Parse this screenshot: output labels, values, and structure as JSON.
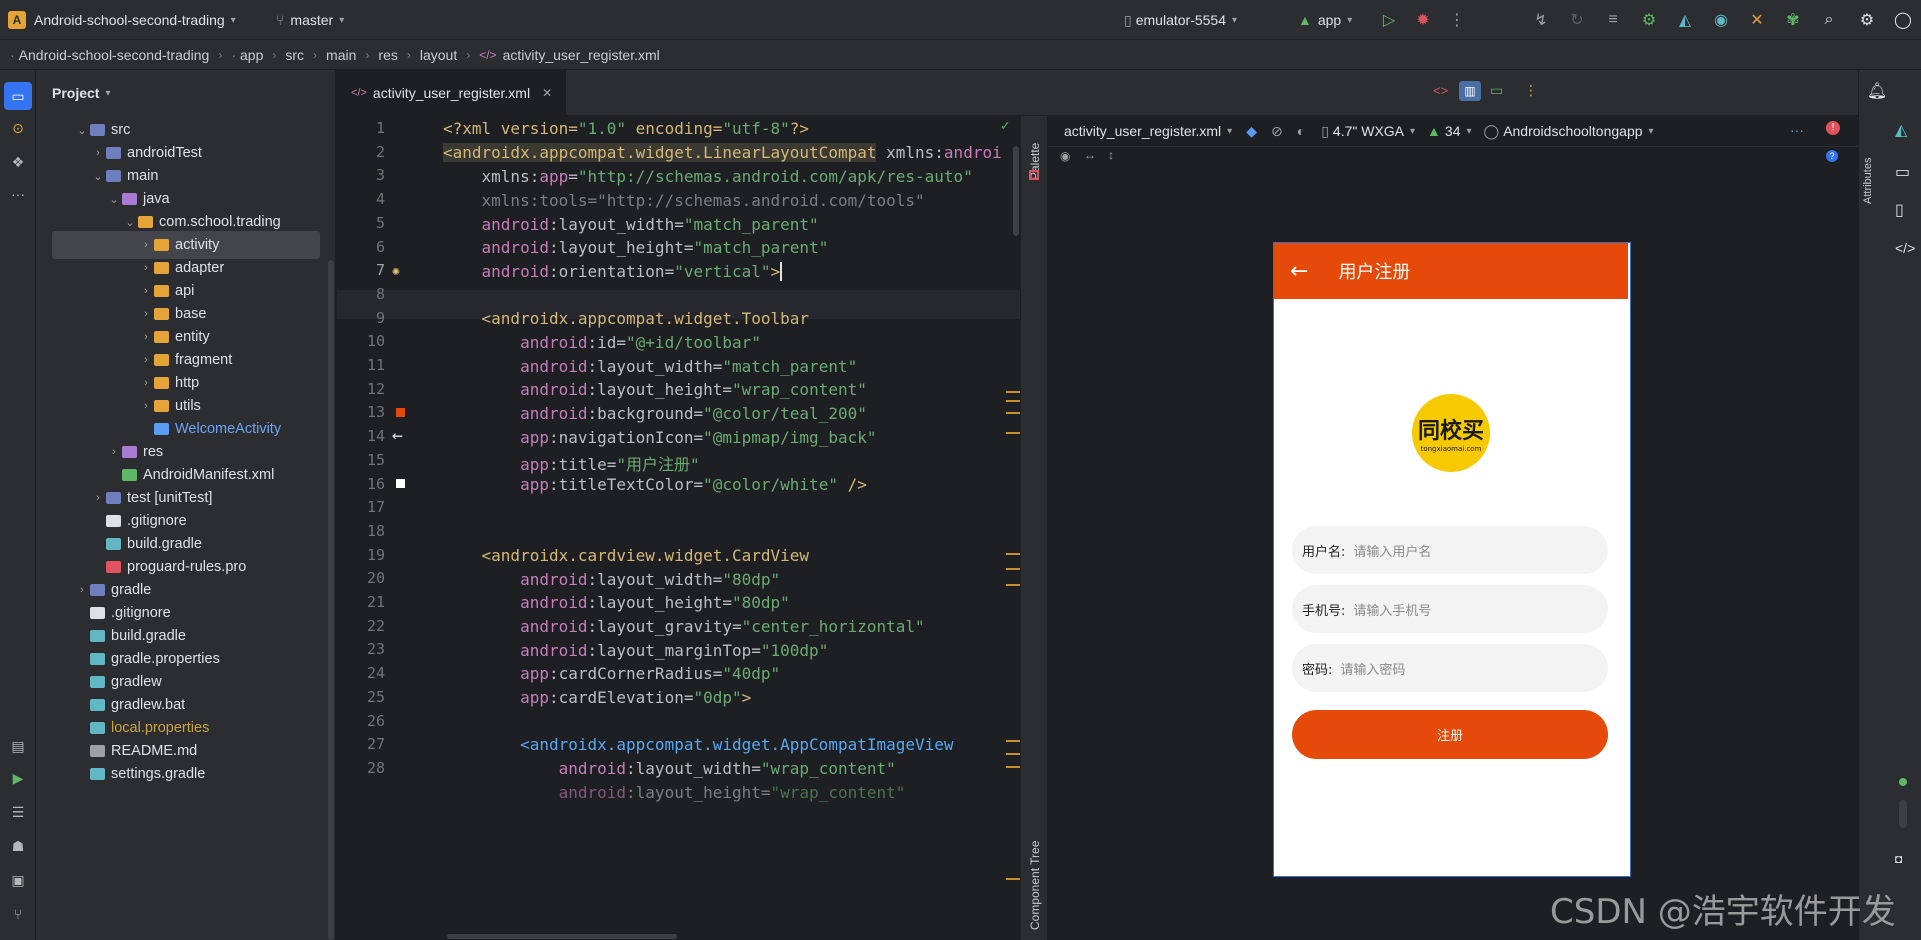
{
  "titlebar": {
    "project_badge": "A",
    "project_name": "Android-school-second-trading",
    "branch": "master",
    "device": "emulator-5554",
    "run_config": "app"
  },
  "breadcrumbs": [
    "Android-school-second-trading",
    "app",
    "src",
    "main",
    "res",
    "layout",
    "activity_user_register.xml"
  ],
  "project_panel": {
    "title": "Project",
    "tree": [
      {
        "label": "src",
        "arrow": "down",
        "depth": 0,
        "icon": "folder"
      },
      {
        "label": "androidTest",
        "arrow": "right",
        "depth": 1,
        "icon": "folder"
      },
      {
        "label": "main",
        "arrow": "down",
        "depth": 1,
        "icon": "folder"
      },
      {
        "label": "java",
        "arrow": "down",
        "depth": 2,
        "icon": "folder-java"
      },
      {
        "label": "com.school.trading",
        "arrow": "down",
        "depth": 3,
        "icon": "package"
      },
      {
        "label": "activity",
        "arrow": "right",
        "depth": 4,
        "icon": "package",
        "selected": true
      },
      {
        "label": "adapter",
        "arrow": "right",
        "depth": 4,
        "icon": "package"
      },
      {
        "label": "api",
        "arrow": "right",
        "depth": 4,
        "icon": "package"
      },
      {
        "label": "base",
        "arrow": "right",
        "depth": 4,
        "icon": "package"
      },
      {
        "label": "entity",
        "arrow": "right",
        "depth": 4,
        "icon": "package"
      },
      {
        "label": "fragment",
        "arrow": "right",
        "depth": 4,
        "icon": "package"
      },
      {
        "label": "http",
        "arrow": "right",
        "depth": 4,
        "icon": "package"
      },
      {
        "label": "utils",
        "arrow": "right",
        "depth": 4,
        "icon": "package"
      },
      {
        "label": "WelcomeActivity",
        "arrow": "",
        "depth": 4,
        "icon": "class"
      },
      {
        "label": "res",
        "arrow": "right",
        "depth": 2,
        "icon": "folder-res"
      },
      {
        "label": "AndroidManifest.xml",
        "arrow": "",
        "depth": 2,
        "icon": "manifest"
      },
      {
        "label": "test [unitTest]",
        "arrow": "right",
        "depth": 1,
        "icon": "folder"
      },
      {
        "label": ".gitignore",
        "arrow": "",
        "depth": 1,
        "icon": "git"
      },
      {
        "label": "build.gradle",
        "arrow": "",
        "depth": 1,
        "icon": "gradle"
      },
      {
        "label": "proguard-rules.pro",
        "arrow": "",
        "depth": 1,
        "icon": "pro"
      },
      {
        "label": "gradle",
        "arrow": "right",
        "depth": 0,
        "icon": "folder"
      },
      {
        "label": ".gitignore",
        "arrow": "",
        "depth": 0,
        "icon": "git"
      },
      {
        "label": "build.gradle",
        "arrow": "",
        "depth": 0,
        "icon": "gradle"
      },
      {
        "label": "gradle.properties",
        "arrow": "",
        "depth": 0,
        "icon": "properties"
      },
      {
        "label": "gradlew",
        "arrow": "",
        "depth": 0,
        "icon": "gradle"
      },
      {
        "label": "gradlew.bat",
        "arrow": "",
        "depth": 0,
        "icon": "gradle"
      },
      {
        "label": "local.properties",
        "arrow": "",
        "depth": 0,
        "icon": "properties",
        "warn": true
      },
      {
        "label": "README.md",
        "arrow": "",
        "depth": 0,
        "icon": "md"
      },
      {
        "label": "settings.gradle",
        "arrow": "",
        "depth": 0,
        "icon": "gradle"
      }
    ]
  },
  "editor": {
    "tab_label": "activity_user_register.xml",
    "line_numbers": [
      "1",
      "2",
      "3",
      "4",
      "5",
      "6",
      "7",
      "8",
      "9",
      "10",
      "11",
      "12",
      "13",
      "14",
      "15",
      "16",
      "17",
      "18",
      "19",
      "20",
      "21",
      "22",
      "23",
      "24",
      "25",
      "26",
      "27",
      "28"
    ],
    "current_line": 7
  },
  "design": {
    "file_label": "activity_user_register.xml",
    "device_label": "4.7\" WXGA",
    "api_label": "34",
    "theme_label": "Androidschooltongapp",
    "palette_label": "Palette",
    "component_tree_label": "Component Tree",
    "attributes_label": "Attributes"
  },
  "phone": {
    "title": "用户注册",
    "logo_text": "同校买",
    "logo_sub": "tongxiaomai.com",
    "fields": [
      {
        "label": "用户名:",
        "placeholder": "请输入用户名"
      },
      {
        "label": "手机号:",
        "placeholder": "请输入手机号"
      },
      {
        "label": "密码:",
        "placeholder": "请输入密码"
      }
    ],
    "button": "注册",
    "accent": "#e64a0b"
  },
  "watermark": "CSDN @浩宇软件开发"
}
